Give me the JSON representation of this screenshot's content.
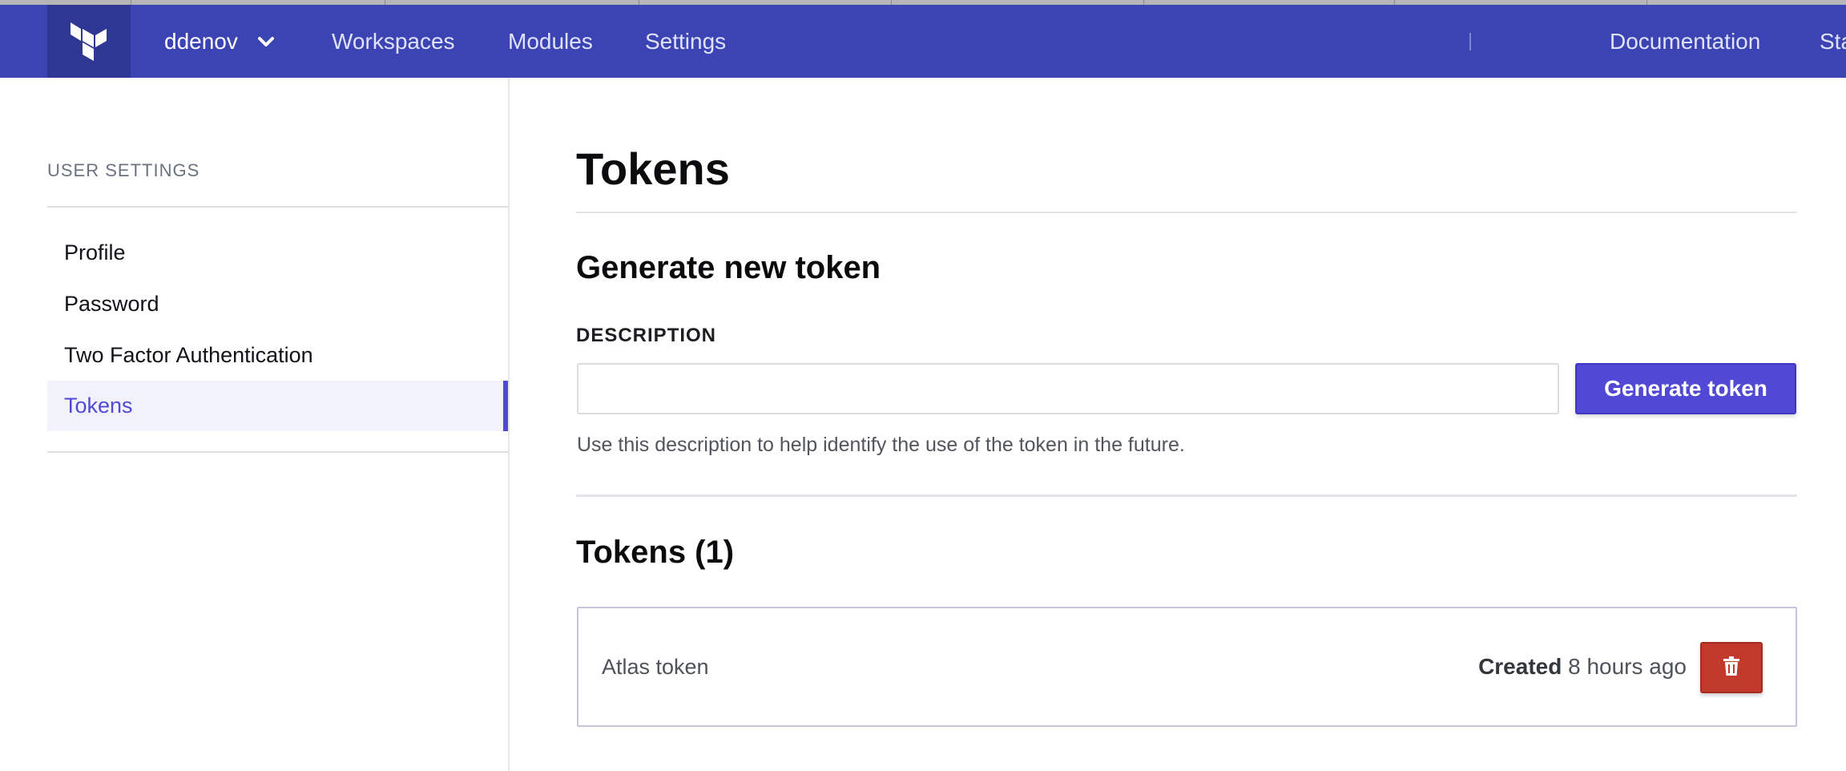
{
  "nav": {
    "org_name": "ddenov",
    "links": [
      "Workspaces",
      "Modules",
      "Settings"
    ],
    "right_links": [
      "Documentation",
      "Sta"
    ]
  },
  "sidebar": {
    "heading": "USER SETTINGS",
    "items": [
      {
        "label": "Profile",
        "active": false
      },
      {
        "label": "Password",
        "active": false
      },
      {
        "label": "Two Factor Authentication",
        "active": false
      },
      {
        "label": "Tokens",
        "active": true
      }
    ]
  },
  "main": {
    "title": "Tokens",
    "generate_heading": "Generate new token",
    "description_label": "DESCRIPTION",
    "description_value": "",
    "generate_button": "Generate token",
    "hint": "Use this description to help identify the use of the token in the future.",
    "tokens_heading": "Tokens (1)",
    "tokens": [
      {
        "name": "Atlas token",
        "created_label": "Created",
        "created_value": "8 hours ago"
      }
    ]
  },
  "icons": {
    "logo": "terraform-logo-icon",
    "org_dropdown": "chevron-down-icon",
    "delete": "trash-icon"
  },
  "colors": {
    "nav_bg": "#3c44b4",
    "accent": "#5149d6",
    "danger": "#c13a2c"
  }
}
